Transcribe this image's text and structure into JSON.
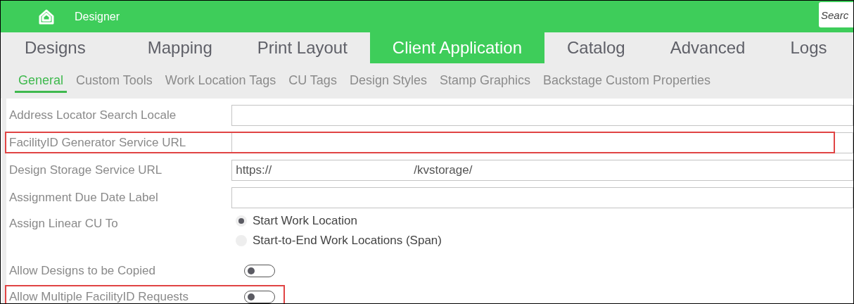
{
  "app_bar": {
    "title": "Designer",
    "search": {
      "placeholder": "Searc"
    }
  },
  "tabs": [
    {
      "label": "Designs",
      "selected": false
    },
    {
      "label": "Mapping",
      "selected": false
    },
    {
      "label": "Print Layout",
      "selected": false
    },
    {
      "label": "Client Application",
      "selected": true
    },
    {
      "label": "Catalog",
      "selected": false
    },
    {
      "label": "Advanced",
      "selected": false
    },
    {
      "label": "Logs",
      "selected": false
    }
  ],
  "subtabs": [
    {
      "label": "General",
      "selected": true
    },
    {
      "label": "Custom Tools",
      "selected": false
    },
    {
      "label": "Work Location Tags",
      "selected": false
    },
    {
      "label": "CU Tags",
      "selected": false
    },
    {
      "label": "Design Styles",
      "selected": false
    },
    {
      "label": "Stamp Graphics",
      "selected": false
    },
    {
      "label": "Backstage Custom Properties",
      "selected": false
    }
  ],
  "settings": [
    {
      "kind": "text",
      "label": "Address Locator Search Locale",
      "highlighted": false
    },
    {
      "kind": "text",
      "label": "FacilityID Generator Service URL",
      "highlighted": true
    },
    {
      "kind": "text",
      "label": "Design Storage Service URL",
      "highlighted": false,
      "value_parts": [
        "https://",
        "/kvstorage/"
      ]
    },
    {
      "kind": "text",
      "label": "Assignment Due Date Label",
      "highlighted": false
    },
    {
      "kind": "radio",
      "label": "Assign Linear CU To",
      "highlighted": false,
      "options": [
        {
          "label": "Start Work Location",
          "selected": true
        },
        {
          "label": "Start-to-End Work Locations (Span)",
          "selected": false
        }
      ]
    },
    {
      "kind": "toggle",
      "label": "Allow Designs to be Copied",
      "highlighted": false,
      "on": false
    },
    {
      "kind": "toggle",
      "label": "Allow Multiple FacilityID Requests",
      "highlighted": true,
      "on": false
    }
  ]
}
